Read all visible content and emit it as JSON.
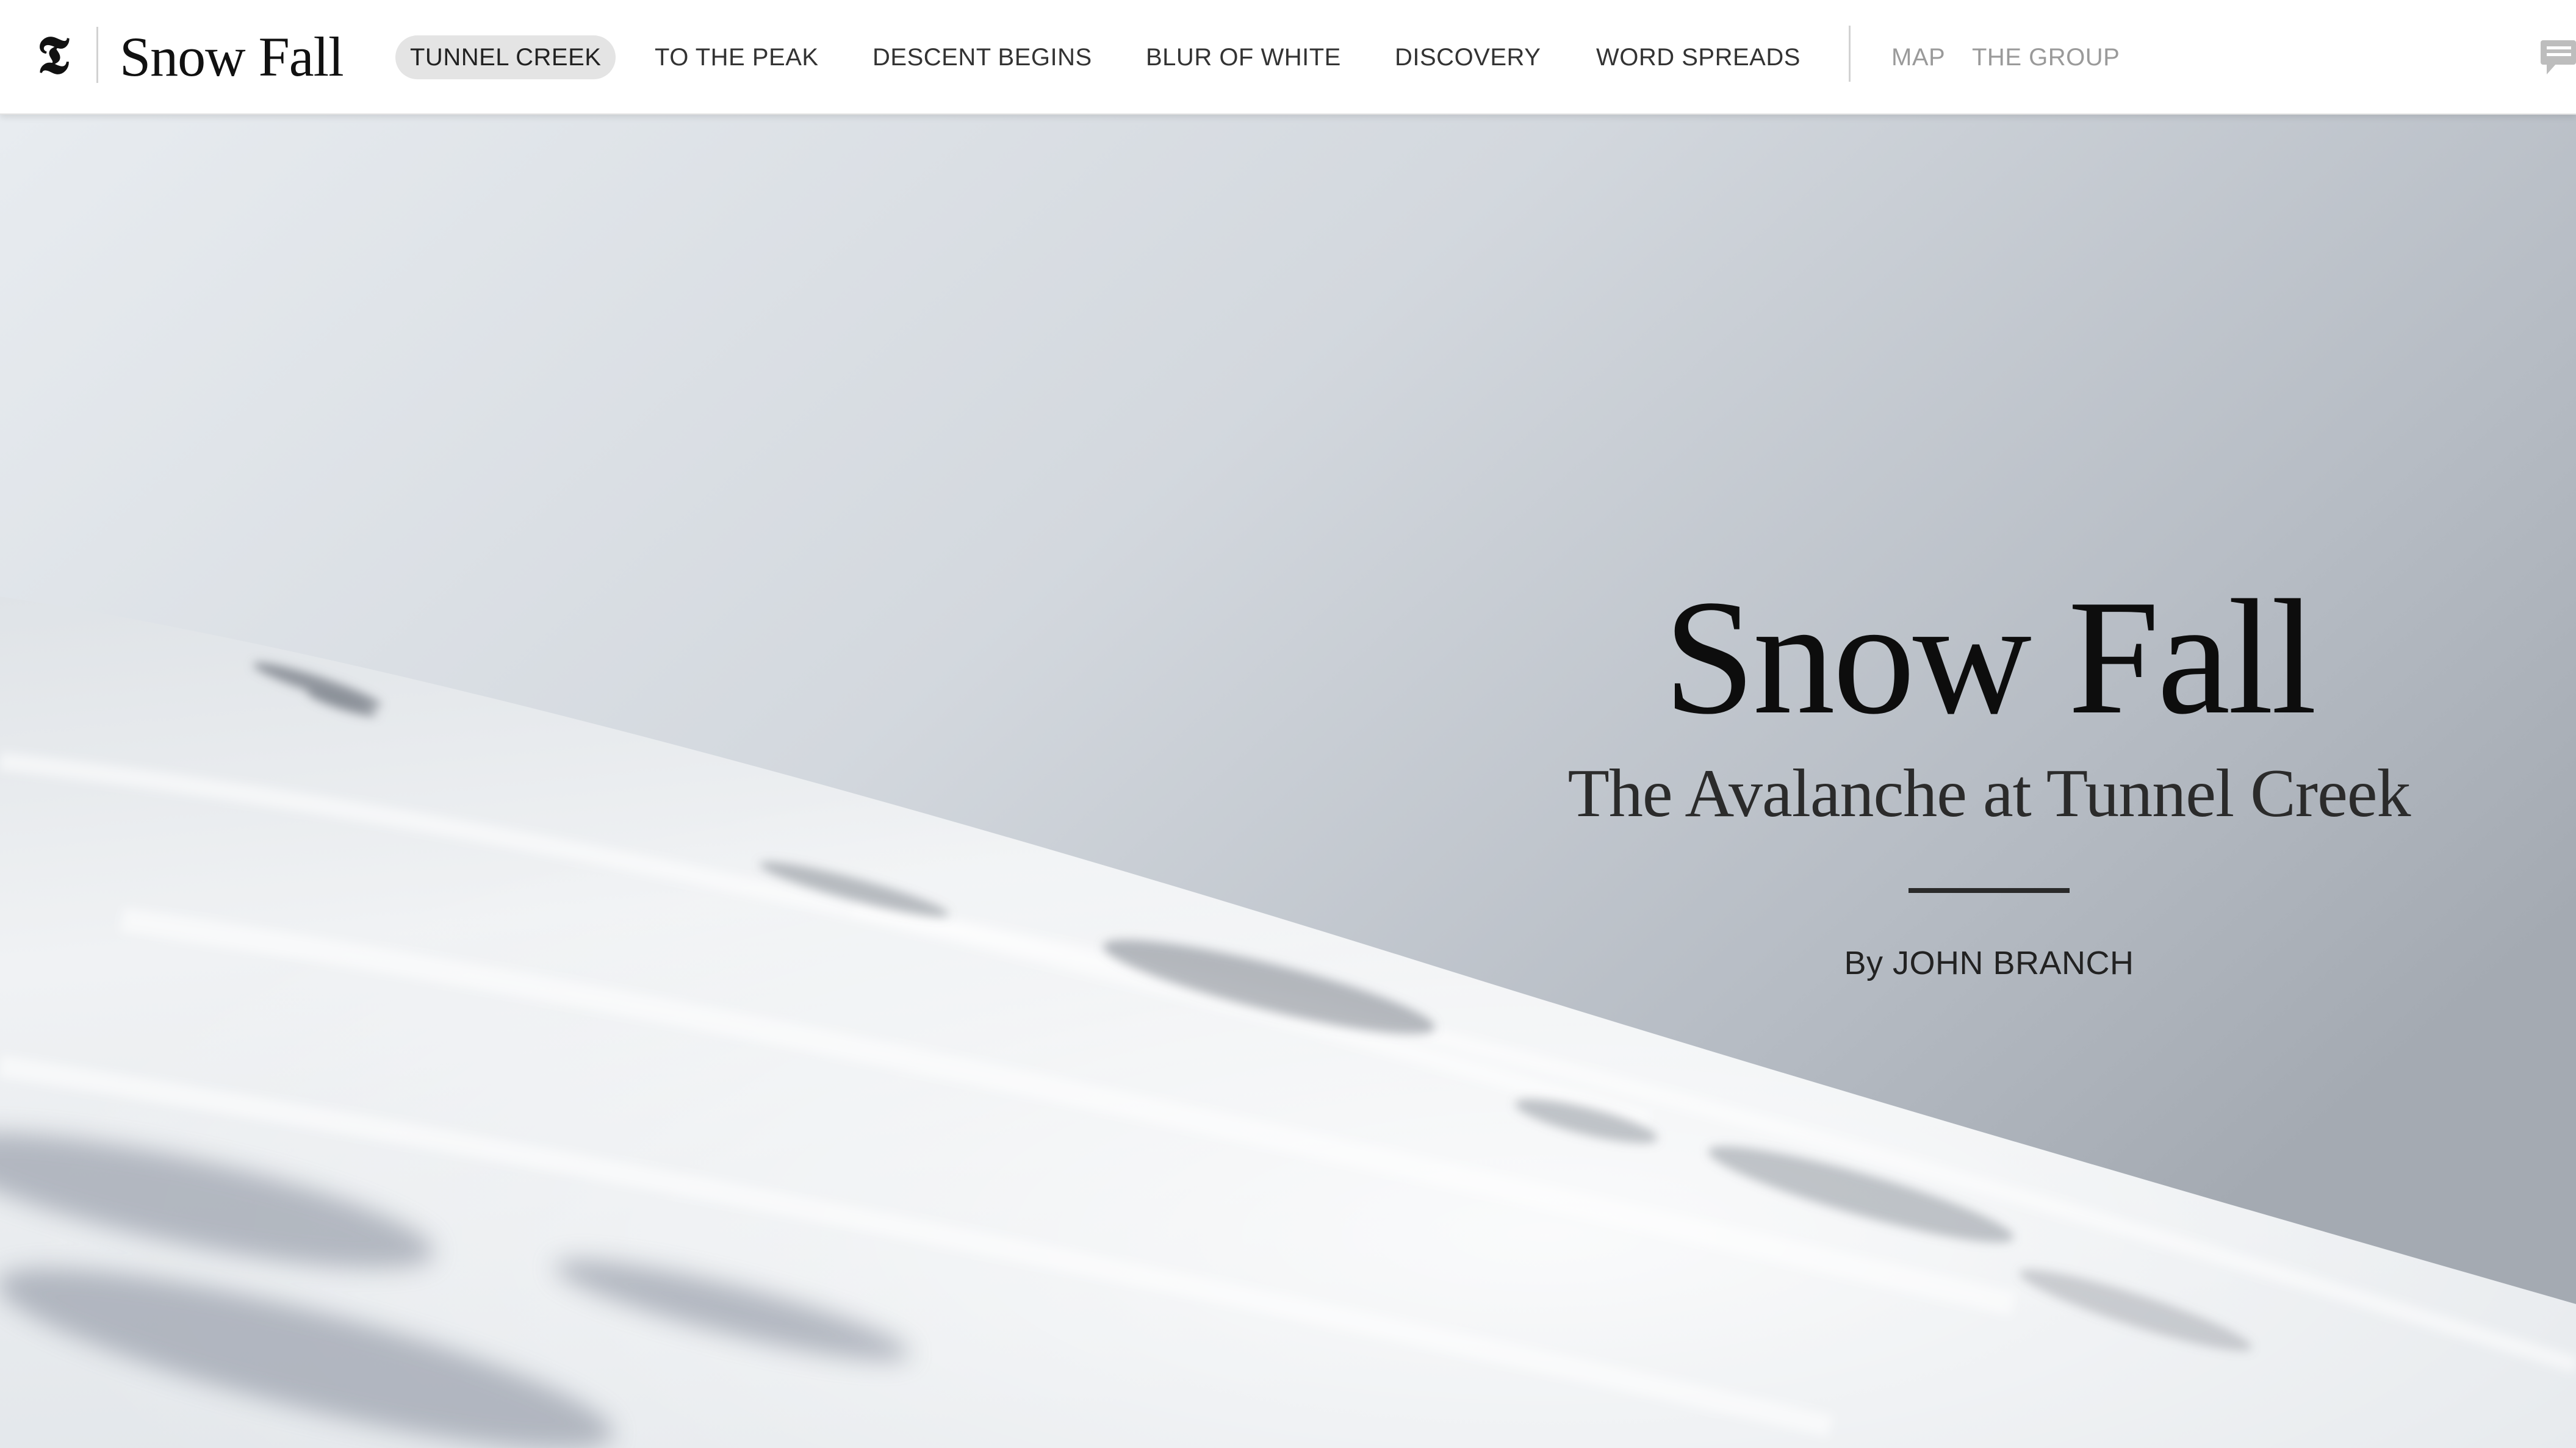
{
  "brand": {
    "logo_glyph": "𝕿",
    "name": "Snow Fall"
  },
  "nav": {
    "items": [
      {
        "label": "TUNNEL CREEK",
        "active": true
      },
      {
        "label": "TO THE PEAK",
        "active": false
      },
      {
        "label": "DESCENT BEGINS",
        "active": false
      },
      {
        "label": "BLUR OF WHITE",
        "active": false
      },
      {
        "label": "DISCOVERY",
        "active": false
      },
      {
        "label": "WORD SPREADS",
        "active": false
      }
    ],
    "secondary": [
      {
        "label": "MAP"
      },
      {
        "label": "THE GROUP"
      }
    ],
    "comment_icon": "comment-icon"
  },
  "hero": {
    "title": "Snow Fall",
    "subtitle": "The Avalanche at Tunnel Creek",
    "byline": "By JOHN BRANCH"
  },
  "colors": {
    "nav_background": "#ffffff",
    "active_pill": "#e4e4e4",
    "muted_link": "#9a9a9a",
    "sky": "#c9ced5",
    "snow": "#f4f6f8"
  }
}
